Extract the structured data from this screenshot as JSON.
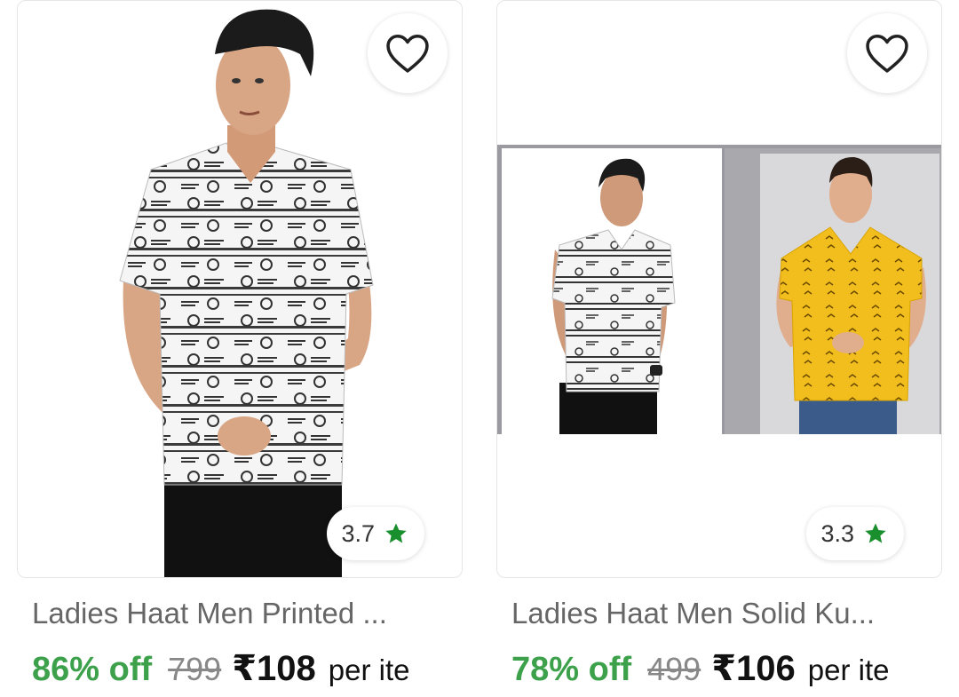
{
  "products": [
    {
      "title": "Ladies Haat Men Printed ...",
      "discount": "86% off",
      "mrp": "799",
      "price": "₹108",
      "unit": "per ite",
      "rating": "3.7"
    },
    {
      "title": "Ladies Haat Men Solid Ku...",
      "discount": "78% off",
      "mrp": "499",
      "price": "₹106",
      "unit": "per ite",
      "rating": "3.3"
    }
  ],
  "colors": {
    "discount": "#3ca14a",
    "rating_star": "#1a8f2e",
    "card_border": "#e6e6e6"
  },
  "icons": {
    "wishlist": "heart-outline-icon",
    "rating": "star-icon"
  }
}
